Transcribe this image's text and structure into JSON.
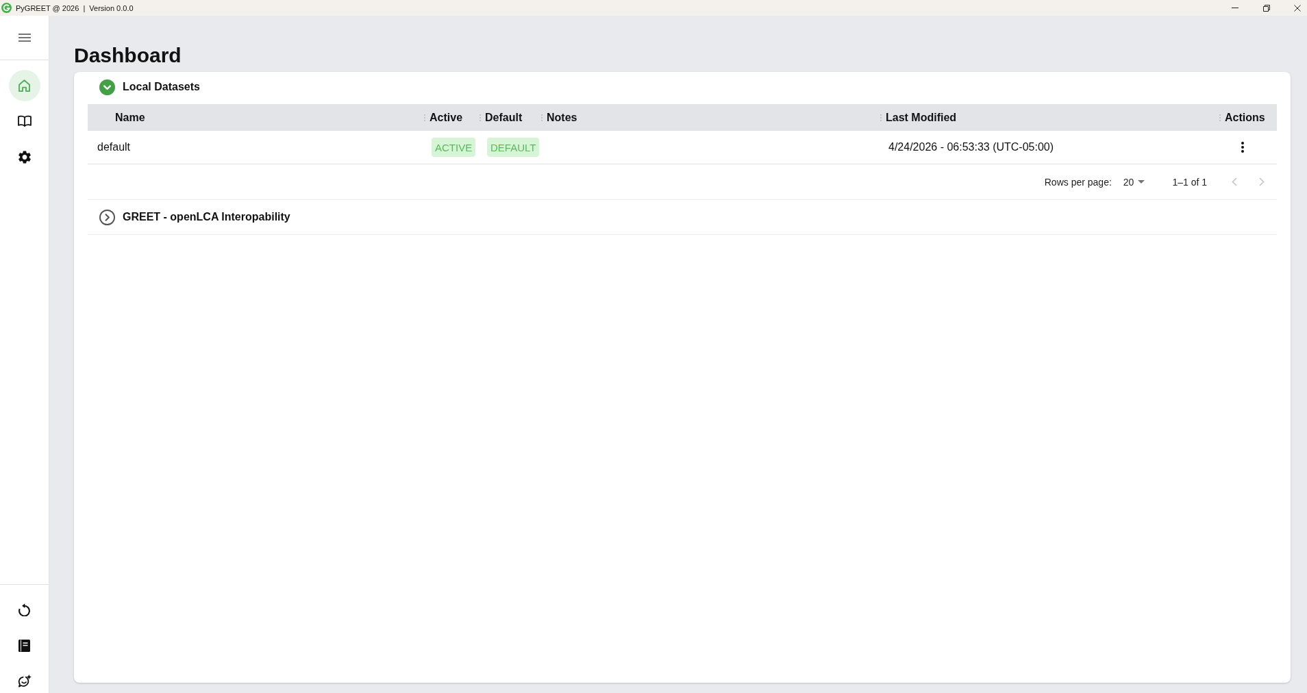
{
  "window": {
    "title": "PyGREET @ 2026  |  Version 0.0.0",
    "controls": [
      {
        "kind": "minimize"
      },
      {
        "kind": "restore"
      },
      {
        "kind": "close"
      }
    ]
  },
  "sidebar": {
    "items": [
      {
        "kind": "home",
        "selected": true
      },
      {
        "kind": "book",
        "selected": false
      },
      {
        "kind": "settings",
        "selected": false
      }
    ],
    "footer_items": [
      {
        "kind": "refresh"
      },
      {
        "kind": "manual"
      },
      {
        "kind": "feedback"
      }
    ]
  },
  "page": {
    "title": "Dashboard"
  },
  "sections": [
    {
      "title": "Local Datasets",
      "expanded": true,
      "table": {
        "columns": [
          "Name",
          "Active",
          "Default",
          "Notes",
          "Last Modified",
          "Actions"
        ],
        "rows": [
          {
            "name": "default",
            "active": "ACTIVE",
            "default": "DEFAULT",
            "last_modified": "4/24/2026 - 06:53:33 (UTC-05:00)"
          }
        ]
      },
      "pagination": {
        "rows_per_page_label": "Rows per page:",
        "rows_per_page": "20",
        "range": "1–1 of 1",
        "previous_disabled": true,
        "next_disabled": true
      }
    },
    {
      "title": "GREET - openLCA Interopability",
      "expanded": false
    }
  ]
}
